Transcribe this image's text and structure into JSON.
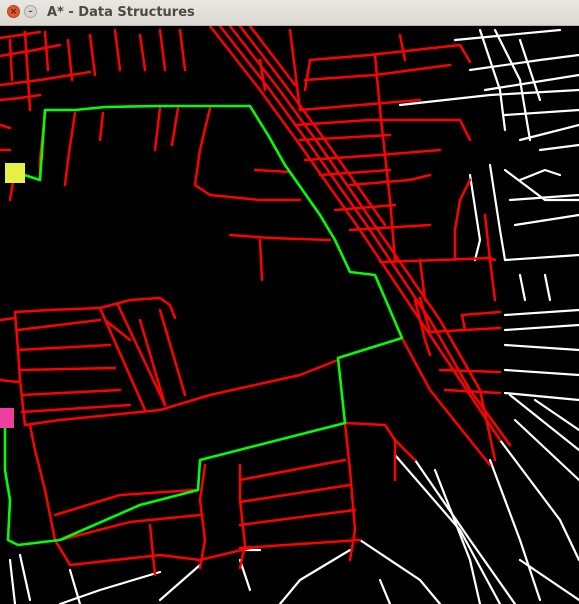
{
  "window": {
    "title": "A* - Data Structures",
    "close_glyph": "×",
    "minimize_glyph": "–"
  },
  "map": {
    "colors": {
      "visited_road": "#ff0000",
      "path": "#00ff00",
      "unvisited_road": "#ffffff",
      "start_marker": "#e6f046",
      "goal_marker": "#ee3fa0",
      "background": "#000000"
    }
  }
}
